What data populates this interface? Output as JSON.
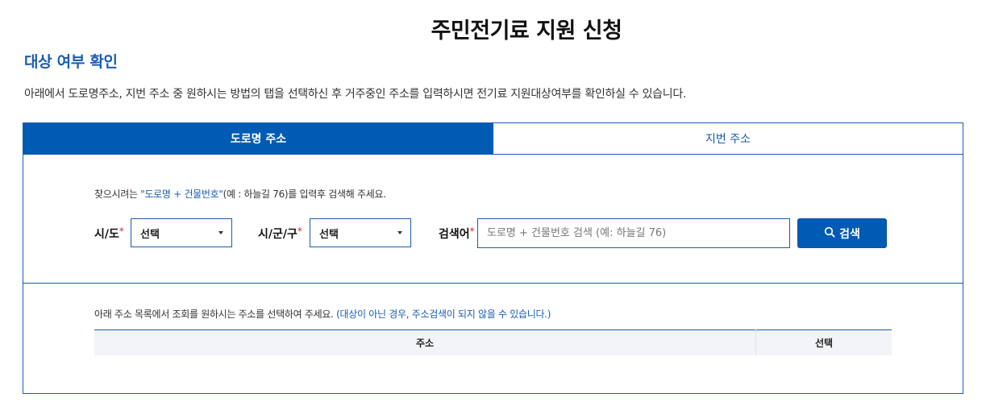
{
  "page": {
    "title": "주민전기료 지원 신청",
    "section_title": "대상 여부 확인",
    "description": "아래에서 도로명주소, 지번 주소 중 원하시는 방법의 탭을 선택하신 후 거주중인 주소를 입력하시면 전기료 지원대상여부를 확인하실 수 있습니다."
  },
  "tabs": [
    {
      "label": "도로명 주소",
      "active": true
    },
    {
      "label": "지번 주소",
      "active": false
    }
  ],
  "search": {
    "hint_prefix": "찾으시려는 ",
    "hint_highlight": "\"도로명 + 건물번호\"",
    "hint_suffix": "(예 : 하늘길 76)를 입력후 검색해 주세요.",
    "sido_label": "시/도",
    "sido_value": "선택",
    "sigungu_label": "시/군/구",
    "sigungu_value": "선택",
    "keyword_label": "검색어",
    "required_mark": "*",
    "keyword_value": "",
    "keyword_placeholder": "도로명 + 건물번호 검색 (예: 하늘길 76)",
    "button_label": "검색",
    "button_icon": "search-icon"
  },
  "results": {
    "hint_text": "아래 주소 목록에서 조회를 원하시는 주소를 선택하여 주세요. ",
    "hint_highlight": "(대상이 아닌 경우, 주소검색이 되지 않을 수 있습니다.)",
    "columns": [
      "주소",
      "선택"
    ],
    "rows": []
  },
  "colors": {
    "primary": "#005bb5",
    "accent_text": "#1a5cb0",
    "required": "#d9262c",
    "table_header_bg": "#f2f4f7"
  }
}
